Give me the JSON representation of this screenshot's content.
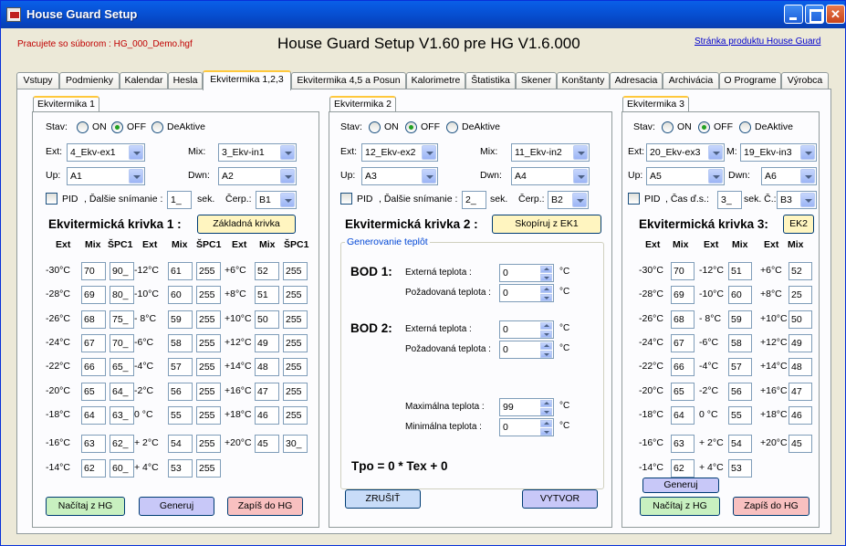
{
  "window": {
    "title": "House Guard Setup"
  },
  "header": {
    "file_label": "Pracujete so súborom : HG_000_Demo.hgf",
    "main_title": "House Guard Setup V1.60 pre HG V1.6.000",
    "product_link": "Stránka produktu House Guard"
  },
  "tabs": [
    {
      "label": "Vstupy"
    },
    {
      "label": "Podmienky"
    },
    {
      "label": "Kalendar"
    },
    {
      "label": "Hesla"
    },
    {
      "label": "Ekvitermika 1,2,3"
    },
    {
      "label": "Ekvitermika 4,5 a Posun"
    },
    {
      "label": "Kalorimetre"
    },
    {
      "label": "Štatistika"
    },
    {
      "label": "Skener"
    },
    {
      "label": "Konštanty"
    },
    {
      "label": "Adresacia"
    },
    {
      "label": "Archivácia"
    },
    {
      "label": "O Programe"
    },
    {
      "label": "Výrobca"
    }
  ],
  "common": {
    "stav": "Stav:",
    "on": "ON",
    "off": "OFF",
    "deaktive": "DeAktive",
    "ext": "Ext:",
    "mix": "Mix:",
    "up": "Up:",
    "dwn": "Dwn:",
    "m": "M:",
    "pid": "PID",
    "dalsie": ", Ďalšie snímanie :",
    "cas": ", Čas ď.s.:",
    "sek": "sek.",
    "sek_c": "sek. Č.:",
    "cerp": "Čerp.:",
    "col_ext": "Ext",
    "col_mix": "Mix",
    "col_spc": "ŠPC1"
  },
  "ek1": {
    "tab": "Ekvitermika 1",
    "ext_sel": "4_Ekv-ex1",
    "mix_sel": "3_Ekv-in1",
    "up_sel": "A1",
    "dwn_sel": "A2",
    "scan": "1_",
    "cerp_sel": "B1",
    "curve_title": "Ekvitermická krivka 1 :",
    "curve_button": "Základná krivka",
    "rows": [
      {
        "t1": "-30°C",
        "m1": "70",
        "s1": "90_",
        "t2": "-12°C",
        "m2": "61",
        "s2": "255",
        "t3": "+6°C",
        "m3": "52",
        "s3": "255"
      },
      {
        "t1": "-28°C",
        "m1": "69",
        "s1": "80_",
        "t2": "-10°C",
        "m2": "60",
        "s2": "255",
        "t3": "+8°C",
        "m3": "51",
        "s3": "255"
      },
      {
        "t1": "-26°C",
        "m1": "68",
        "s1": "75_",
        "t2": "- 8°C",
        "m2": "59",
        "s2": "255",
        "t3": "+10°C",
        "m3": "50",
        "s3": "255"
      },
      {
        "t1": "-24°C",
        "m1": "67",
        "s1": "70_",
        "t2": "-6°C",
        "m2": "58",
        "s2": "255",
        "t3": "+12°C",
        "m3": "49",
        "s3": "255"
      },
      {
        "t1": "-22°C",
        "m1": "66",
        "s1": "65_",
        "t2": "-4°C",
        "m2": "57",
        "s2": "255",
        "t3": "+14°C",
        "m3": "48",
        "s3": "255"
      },
      {
        "t1": "-20°C",
        "m1": "65",
        "s1": "64_",
        "t2": "-2°C",
        "m2": "56",
        "s2": "255",
        "t3": "+16°C",
        "m3": "47",
        "s3": "255"
      },
      {
        "t1": "-18°C",
        "m1": "64",
        "s1": "63_",
        "t2": "0 °C",
        "m2": "55",
        "s2": "255",
        "t3": "+18°C",
        "m3": "46",
        "s3": "255"
      },
      {
        "t1": "-16°C",
        "m1": "63",
        "s1": "62_",
        "t2": "+ 2°C",
        "m2": "54",
        "s2": "255",
        "t3": "+20°C",
        "m3": "45",
        "s3": "30_"
      },
      {
        "t1": "-14°C",
        "m1": "62",
        "s1": "60_",
        "t2": "+ 4°C",
        "m2": "53",
        "s2": "255"
      }
    ],
    "btn_load": "Načítaj z HG",
    "btn_gen": "Generuj",
    "btn_write": "Zapíš do HG"
  },
  "ek2": {
    "tab": "Ekvitermika 2",
    "ext_sel": "12_Ekv-ex2",
    "mix_sel": "11_Ekv-in2",
    "up_sel": "A3",
    "dwn_sel": "A4",
    "scan": "2_",
    "cerp_sel": "B2",
    "curve_title": "Ekvitermická krivka 2 :",
    "curve_button": "Skopíruj z EK1",
    "gen_legend": "Generovanie teplôt",
    "bod1": "BOD 1:",
    "bod2": "BOD 2:",
    "ext_temp": "Externá teplota :",
    "req_temp": "Požadovaná teplota :",
    "max_temp": "Maximálna teplota :",
    "min_temp": "Minimálna teplota :",
    "unit": "°C",
    "b1_ext": "0",
    "b1_req": "0",
    "b2_ext": "0",
    "b2_req": "0",
    "max": "99",
    "min": "0",
    "formula": "Tpo = 0 * Tex + 0",
    "btn_cancel": "ZRUŠIŤ",
    "btn_create": "VYTVOR"
  },
  "ek3": {
    "tab": "Ekvitermika 3",
    "ext_sel": "20_Ekv-ex3",
    "mix_sel": "19_Ekv-in3",
    "up_sel": "A5",
    "dwn_sel": "A6",
    "scan": "3_",
    "cerp_sel": "B3",
    "curve_title": "Ekvitermická krivka  3:",
    "curve_button": "EK2",
    "rows": [
      {
        "t1": "-30°C",
        "m1": "70",
        "t2": "-12°C",
        "m2": "51",
        "t3": "+6°C",
        "m3": "52"
      },
      {
        "t1": "-28°C",
        "m1": "69",
        "t2": "-10°C",
        "m2": "60",
        "t3": "+8°C",
        "m3": "25"
      },
      {
        "t1": "-26°C",
        "m1": "68",
        "t2": "- 8°C",
        "m2": "59",
        "t3": "+10°C",
        "m3": "50"
      },
      {
        "t1": "-24°C",
        "m1": "67",
        "t2": "-6°C",
        "m2": "58",
        "t3": "+12°C",
        "m3": "49"
      },
      {
        "t1": "-22°C",
        "m1": "66",
        "t2": "-4°C",
        "m2": "57",
        "t3": "+14°C",
        "m3": "48"
      },
      {
        "t1": "-20°C",
        "m1": "65",
        "t2": "-2°C",
        "m2": "56",
        "t3": "+16°C",
        "m3": "47"
      },
      {
        "t1": "-18°C",
        "m1": "64",
        "t2": "0 °C",
        "m2": "55",
        "t3": "+18°C",
        "m3": "46"
      },
      {
        "t1": "-16°C",
        "m1": "63",
        "t2": "+ 2°C",
        "m2": "54",
        "t3": "+20°C",
        "m3": "45"
      },
      {
        "t1": "-14°C",
        "m1": "62",
        "t2": "+ 4°C",
        "m2": "53"
      }
    ],
    "btn_gen": "Generuj",
    "btn_load": "Načítaj z HG",
    "btn_write": "Zapíš do HG"
  }
}
